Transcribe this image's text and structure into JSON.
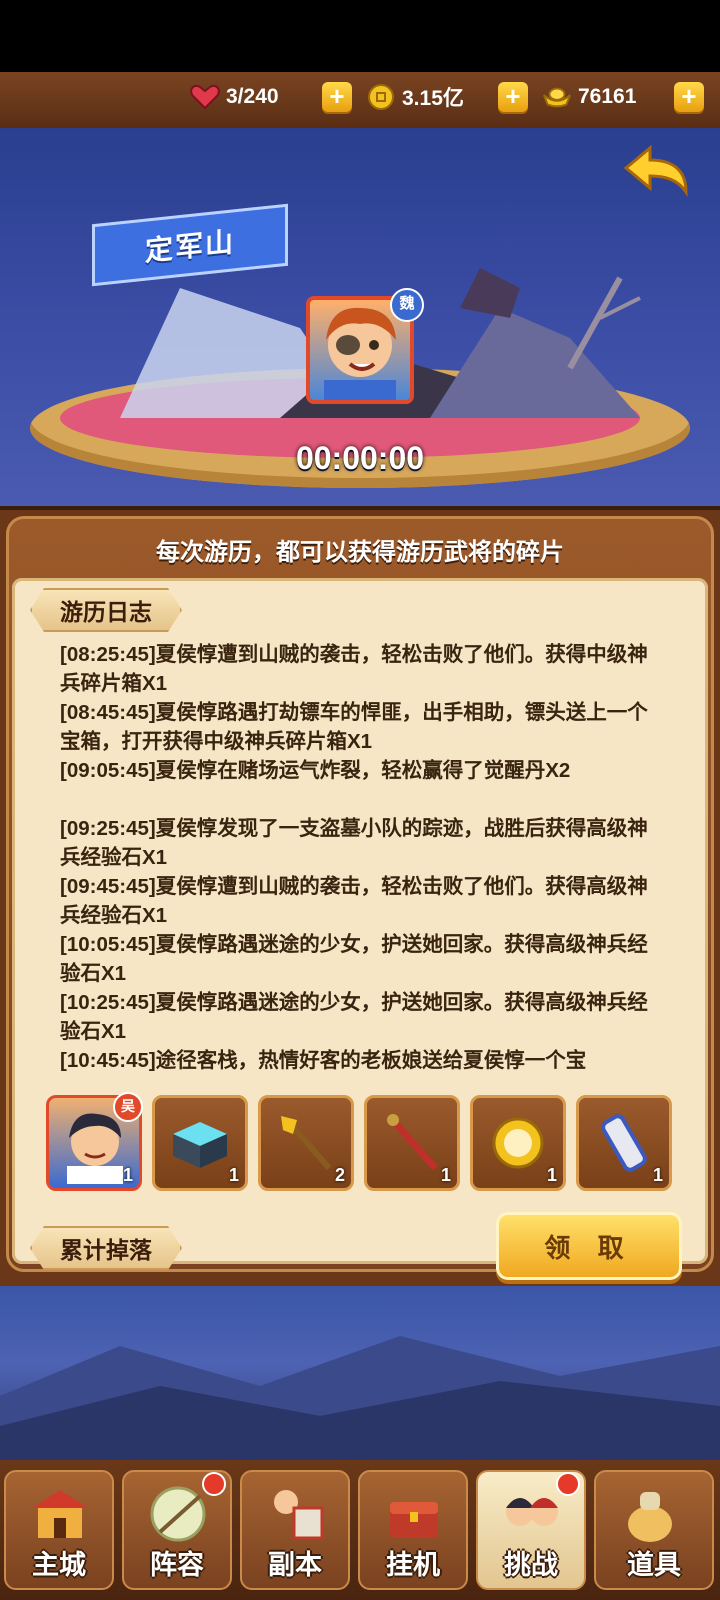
{
  "resources": {
    "stamina": {
      "value": "3/240",
      "icon": "heart-icon",
      "color": "#e03a4a"
    },
    "coins": {
      "value": "3.15亿",
      "icon": "coin-icon",
      "color": "#f4c21e"
    },
    "gold": {
      "value": "76161",
      "icon": "gold-ingot-icon",
      "color": "#f4c21e"
    },
    "add_label": "+"
  },
  "scene": {
    "location": "定军山",
    "hero_faction": "魏",
    "timer": "00:00:00"
  },
  "panel": {
    "subtitle": "每次游历，都可以获得游历武将的碎片",
    "log_tab": "游历日志",
    "drops_tab": "累计掉落",
    "claim_label": "领 取",
    "log_lines": [
      "[08:25:45]夏侯惇遭到山贼的袭击，轻松击败了他们。获得中级神兵碎片箱X1",
      "[08:45:45]夏侯惇路遇打劫镖车的悍匪，出手相助，镖头送上一个宝箱，打开获得中级神兵碎片箱X1",
      "[09:05:45]夏侯惇在赌场运气炸裂，轻松赢得了觉醒丹X2",
      "",
      "[09:25:45]夏侯惇发现了一支盗墓小队的踪迹，战胜后获得高级神兵经验石X1",
      "[09:45:45]夏侯惇遭到山贼的袭击，轻松击败了他们。获得高级神兵经验石X1",
      "[10:05:45]夏侯惇路遇迷途的少女，护送她回家。获得高级神兵经验石X1",
      "[10:25:45]夏侯惇路遇迷途的少女，护送她回家。获得高级神兵经验石X1",
      "[10:45:45]途径客栈，热情好客的老板娘送给夏侯惇一个宝"
    ],
    "items": [
      {
        "name": "hero-fragment",
        "badge": "吴",
        "count": "1"
      },
      {
        "name": "tech-box",
        "count": "1"
      },
      {
        "name": "golden-staff",
        "count": "2"
      },
      {
        "name": "red-spear",
        "count": "1"
      },
      {
        "name": "gold-compass",
        "count": "1"
      },
      {
        "name": "scroll-tube",
        "count": "1"
      }
    ]
  },
  "nav": {
    "items": [
      {
        "label": "主城",
        "icon": "city-gate-icon",
        "dot": false,
        "active": false
      },
      {
        "label": "阵容",
        "icon": "formation-icon",
        "dot": true,
        "active": false
      },
      {
        "label": "副本",
        "icon": "dungeon-icon",
        "dot": false,
        "active": false
      },
      {
        "label": "挂机",
        "icon": "idle-chest-icon",
        "dot": false,
        "active": false
      },
      {
        "label": "挑战",
        "icon": "challenge-heroes-icon",
        "dot": true,
        "active": true
      },
      {
        "label": "道具",
        "icon": "items-bag-icon",
        "dot": false,
        "active": false
      }
    ]
  }
}
